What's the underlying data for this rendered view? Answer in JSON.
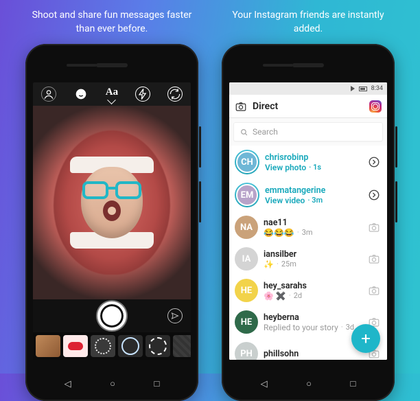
{
  "colors": {
    "accent": "#17a8bb",
    "fab": "#1fb6c9"
  },
  "promo": {
    "left": "Shoot and share fun messages faster than ever before.",
    "right": "Your Instagram friends are instantly added."
  },
  "camera": {
    "tools": {
      "profile": "profile-icon",
      "face_filter": "face-filter-icon",
      "text_label": "Aa",
      "flash": "flash-icon",
      "flip": "flip-camera-icon"
    },
    "shutter": "shutter-button",
    "send": "send-icon",
    "filters": [
      "animal",
      "lips",
      "hearts",
      "ring-blue",
      "ring-white",
      "pattern"
    ]
  },
  "inbox": {
    "status": {
      "time": "8:34"
    },
    "title": "Direct",
    "search_placeholder": "Search",
    "fab_label": "+",
    "threads": [
      {
        "username": "chrisrobinp",
        "subtitle": "View photo",
        "age": "1s",
        "accent": true,
        "story": true,
        "trailing": "chevron",
        "avatar_bg": "#6fb7d6"
      },
      {
        "username": "emmatangerine",
        "subtitle": "View video",
        "age": "3m",
        "accent": true,
        "story": true,
        "trailing": "chevron",
        "avatar_bg": "#b7a3c9"
      },
      {
        "username": "nae11",
        "subtitle": "😂😂😂",
        "age": "3m",
        "accent": false,
        "story": false,
        "trailing": "camera",
        "avatar_bg": "#caa27a"
      },
      {
        "username": "iansilber",
        "subtitle": "✨",
        "age": "25m",
        "accent": false,
        "story": false,
        "trailing": "camera",
        "avatar_bg": "#d4d4d4"
      },
      {
        "username": "hey_sarahs",
        "subtitle": "🌸 ✖️",
        "age": "2d",
        "accent": false,
        "story": false,
        "trailing": "camera",
        "avatar_bg": "#f2d34a"
      },
      {
        "username": "heyberna",
        "subtitle": "Replied to your story",
        "age": "3d",
        "accent": false,
        "story": false,
        "trailing": "camera",
        "avatar_bg": "#2f6a4a"
      },
      {
        "username": "phillsohn",
        "subtitle": "",
        "age": "",
        "accent": false,
        "story": false,
        "trailing": "camera",
        "avatar_bg": "#c9cfce"
      }
    ]
  }
}
